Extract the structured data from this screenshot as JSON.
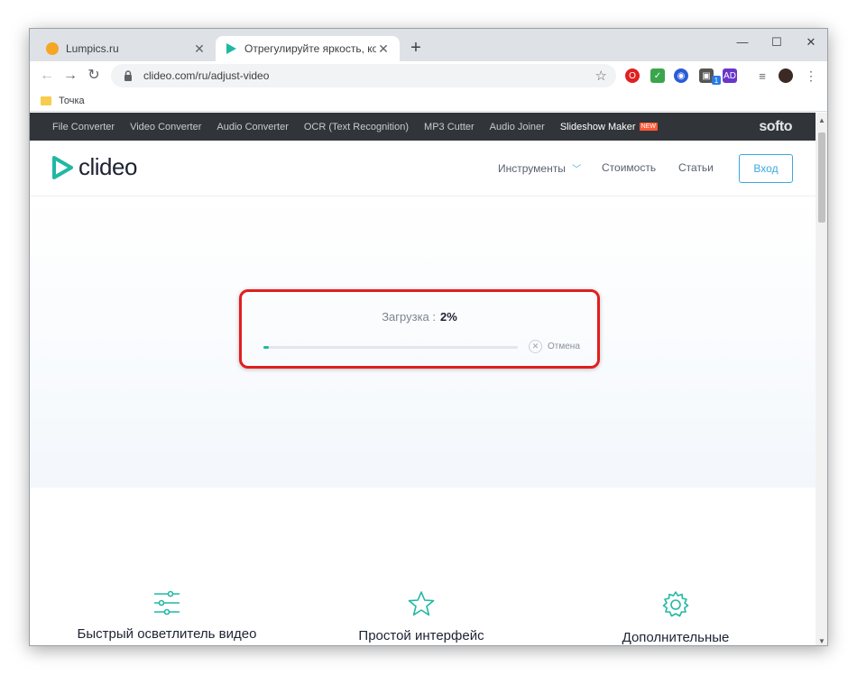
{
  "browser": {
    "tabs": [
      {
        "title": "Lumpics.ru",
        "active": false
      },
      {
        "title": "Отрегулируйте яркость, контра",
        "active": true
      }
    ],
    "url": "clideo.com/ru/adjust-video",
    "bookmark": "Точка",
    "extension_badge": "1"
  },
  "site": {
    "topbar_items": [
      "File Converter",
      "Video Converter",
      "Audio Converter",
      "OCR (Text Recognition)",
      "MP3 Cutter",
      "Audio Joiner",
      "Slideshow Maker"
    ],
    "new_badge": "NEW",
    "softo": "softo",
    "logo": "clideo",
    "nav": {
      "tools": "Инструменты",
      "pricing": "Стоимость",
      "articles": "Статьи",
      "login": "Вход"
    },
    "colors": {
      "accent": "#3ba8e0",
      "brand": "#21b8a3",
      "highlight_border": "#e21e1e",
      "topbar": "#313539"
    }
  },
  "upload": {
    "label": "Загрузка :",
    "percent_text": "2%",
    "progress": 0.02,
    "cancel": "Отмена"
  },
  "features": [
    {
      "icon": "sliders-icon",
      "text": "Быстрый осветлитель видео"
    },
    {
      "icon": "star-icon",
      "text": "Простой интерфейс"
    },
    {
      "icon": "gear-icon",
      "text": "Дополнительные"
    }
  ]
}
